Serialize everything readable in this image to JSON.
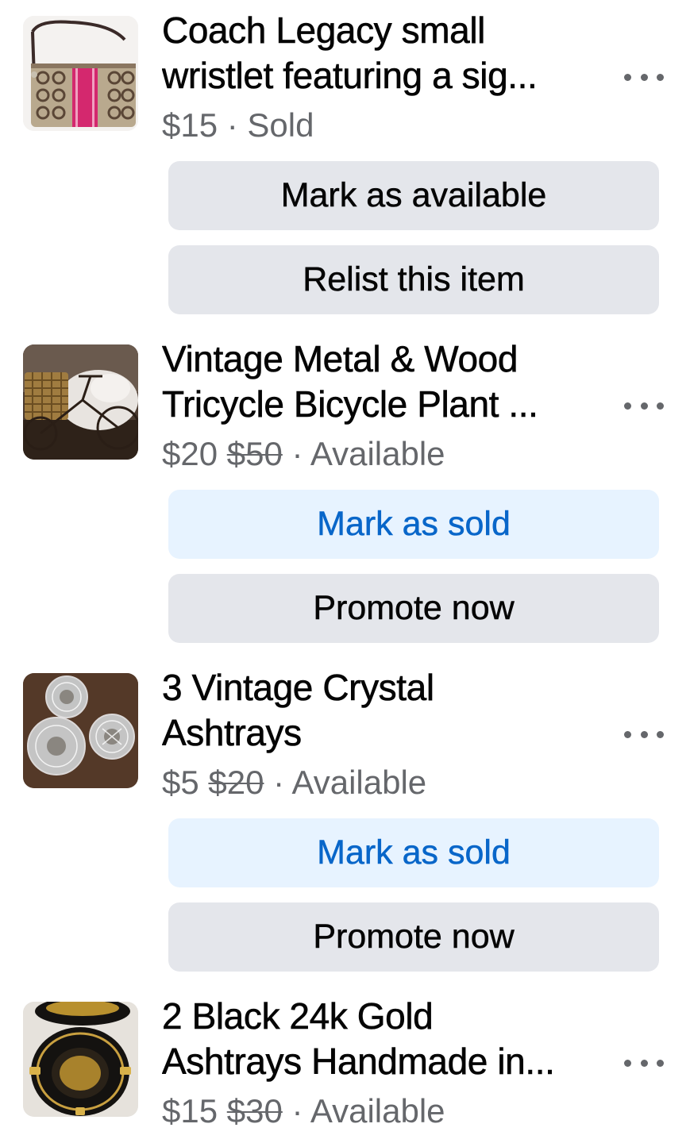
{
  "listings": [
    {
      "title_line1": "Coach Legacy small",
      "title_line2": "wristlet featuring a sig...",
      "price": "$15",
      "original_price": "",
      "separator": " · ",
      "status": "Sold",
      "thumbnail": "handbag-photo",
      "primary_button": "Mark as available",
      "secondary_button": "Relist this item"
    },
    {
      "title_line1": "Vintage Metal & Wood",
      "title_line2": "Tricycle Bicycle Plant ...",
      "price": "$20",
      "original_price": "$50",
      "separator": " · ",
      "status": "Available",
      "thumbnail": "tricycle-planter-photo",
      "primary_button": "Mark as sold",
      "secondary_button": "Promote now"
    },
    {
      "title_line1": "3 Vintage Crystal",
      "title_line2": "Ashtrays",
      "price": "$5",
      "original_price": "$20",
      "separator": " · ",
      "status": "Available",
      "thumbnail": "crystal-ashtrays-photo",
      "primary_button": "Mark as sold",
      "secondary_button": "Promote now"
    },
    {
      "title_line1": "2 Black 24k Gold",
      "title_line2": "Ashtrays Handmade in...",
      "price": "$15",
      "original_price": "$30",
      "separator": " · ",
      "status": "Available",
      "thumbnail": "gold-ashtrays-photo"
    }
  ],
  "colors": {
    "primary_text": "#050505",
    "secondary_text": "#65676b",
    "gray_button": "#e4e6eb",
    "blue_button_bg": "#e7f3ff",
    "blue_button_text": "#0866c9"
  },
  "icons": {
    "more": "more-horizontal-icon"
  }
}
